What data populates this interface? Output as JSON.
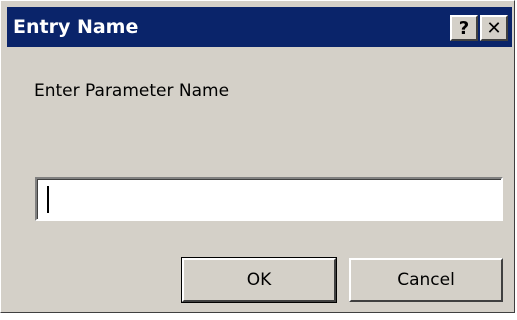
{
  "window": {
    "title": "Entry Name"
  },
  "caption_buttons": {
    "help_label": "?",
    "close_label": "✕"
  },
  "dialog": {
    "prompt": "Enter Parameter Name",
    "input_value": ""
  },
  "buttons": {
    "ok_label": "OK",
    "cancel_label": "Cancel"
  },
  "colors": {
    "titlebar": "#0a246a",
    "face": "#d4d0c8"
  }
}
